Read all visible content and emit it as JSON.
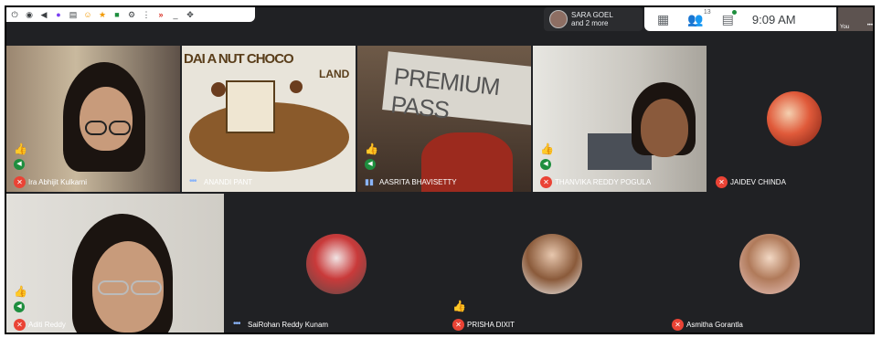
{
  "toolbar_icons": [
    "power-icon",
    "eye-icon",
    "volume-icon",
    "extension-icon",
    "notes-icon",
    "emoji-icon",
    "flag-icon",
    "chat-icon",
    "puzzle-icon",
    "more-icon",
    "chevron-double-icon",
    "minimize-icon",
    "move-icon"
  ],
  "presenter": {
    "line1": "SARA GOEL",
    "line2": "and 2 more"
  },
  "top_controls": {
    "people_count": "13",
    "clock": "9:09 AM",
    "self_label": "You"
  },
  "participants": [
    {
      "name": "Ira Abhijit Kulkarni",
      "status": "muted",
      "reaction": "thumbs-up"
    },
    {
      "name": "ANANDI PANT",
      "status": "speaking-dots"
    },
    {
      "name": "AASRITA BHAVISETTY",
      "status": "speaking-bars",
      "reaction": "thumbs-up",
      "held_sign": "PREMIUM PASS"
    },
    {
      "name": "THANVIKA REDDY POGULA",
      "status": "muted",
      "reaction": "thumbs-up"
    },
    {
      "name": "JAIDEV CHINDA",
      "status": "muted"
    },
    {
      "name": "Aditi Reddy",
      "status": "muted",
      "reaction": "thumbs-up"
    },
    {
      "name": "SaiRohan Reddy Kunam",
      "status": "speaking-dots"
    },
    {
      "name": "PRISHA DIXIT",
      "status": "muted",
      "reaction": "thumbs-up"
    },
    {
      "name": "Asmitha Gorantla",
      "status": "muted"
    }
  ],
  "drawing_text": {
    "line1": "DAI A NUT CHOCO",
    "line2": "LAND"
  },
  "colors": {
    "meet_bg": "#202124",
    "tile_bg": "#3c4043",
    "mute_red": "#ea4335",
    "speak_green": "#1e8e3e",
    "accent_blue": "#8ab4f8"
  }
}
